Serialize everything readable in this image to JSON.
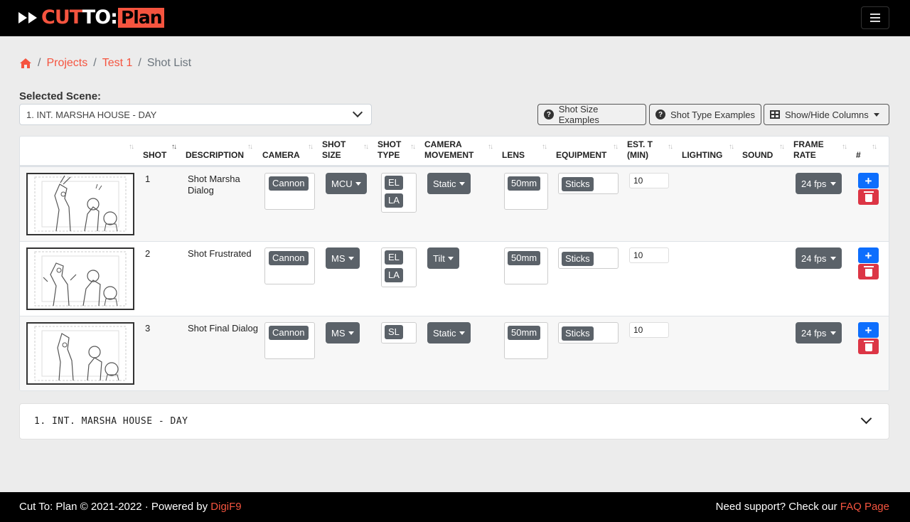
{
  "nav": {
    "logo_cut": "CUT",
    "logo_to": "TO:",
    "logo_plan": "Plan",
    "menu_icon": "hamburger-icon"
  },
  "breadcrumb": {
    "home_icon": "home-icon",
    "items": [
      "Projects",
      "Test 1"
    ],
    "current": "Shot List",
    "separator": "/"
  },
  "scene": {
    "label": "Selected Scene:",
    "selected": "1. INT. MARSHA HOUSE - DAY"
  },
  "toolbar": {
    "shot_size_examples": "Shot Size Examples",
    "shot_type_examples": "Shot Type Examples",
    "show_hide_columns": "Show/Hide Columns"
  },
  "table": {
    "headers": {
      "shot": "SHOT",
      "description": "DESCRIPTION",
      "camera": "CAMERA",
      "shot_size": [
        "SHOT",
        "SIZE"
      ],
      "shot_type": [
        "SHOT",
        "TYPE"
      ],
      "camera_movement": [
        "CAMERA",
        "MOVEMENT"
      ],
      "lens": "LENS",
      "equipment": "EQUIPMENT",
      "est_time": [
        "EST. T",
        "(MIN)"
      ],
      "lighting": "LIGHTING",
      "sound": "SOUND",
      "frame_rate": [
        "FRAME",
        "RATE"
      ],
      "hash": "#"
    },
    "rows": [
      {
        "shot": "1",
        "description": "Shot Marsha Dialog",
        "camera": "Cannon",
        "shot_size": "MCU",
        "shot_type": [
          "EL",
          "LA"
        ],
        "camera_movement": "Static",
        "lens": "50mm",
        "equipment": "Sticks",
        "est_time": "10",
        "frame_rate": "24 fps"
      },
      {
        "shot": "2",
        "description": "Shot Frustrated",
        "camera": "Cannon",
        "shot_size": "MS",
        "shot_type": [
          "EL",
          "LA"
        ],
        "camera_movement": "Tilt",
        "lens": "50mm",
        "equipment": "Sticks",
        "est_time": "10",
        "frame_rate": "24 fps"
      },
      {
        "shot": "3",
        "description": "Shot Final Dialog",
        "camera": "Cannon",
        "shot_size": "MS",
        "shot_type": [
          "SL"
        ],
        "camera_movement": "Static",
        "lens": "50mm",
        "equipment": "Sticks",
        "est_time": "10",
        "frame_rate": "24 fps"
      }
    ]
  },
  "accordion": {
    "title": "1. INT. MARSHA HOUSE - DAY"
  },
  "footer": {
    "left_text": "Cut To: Plan © 2021-2022 · Powered by ",
    "left_link": "DigiF9",
    "right_text": "Need support? Check our ",
    "right_link": "FAQ Page"
  },
  "colors": {
    "accent": "#f5543f",
    "dark_tag": "#5b6269",
    "add_button": "#0d6efd",
    "delete_button": "#dc3545"
  }
}
